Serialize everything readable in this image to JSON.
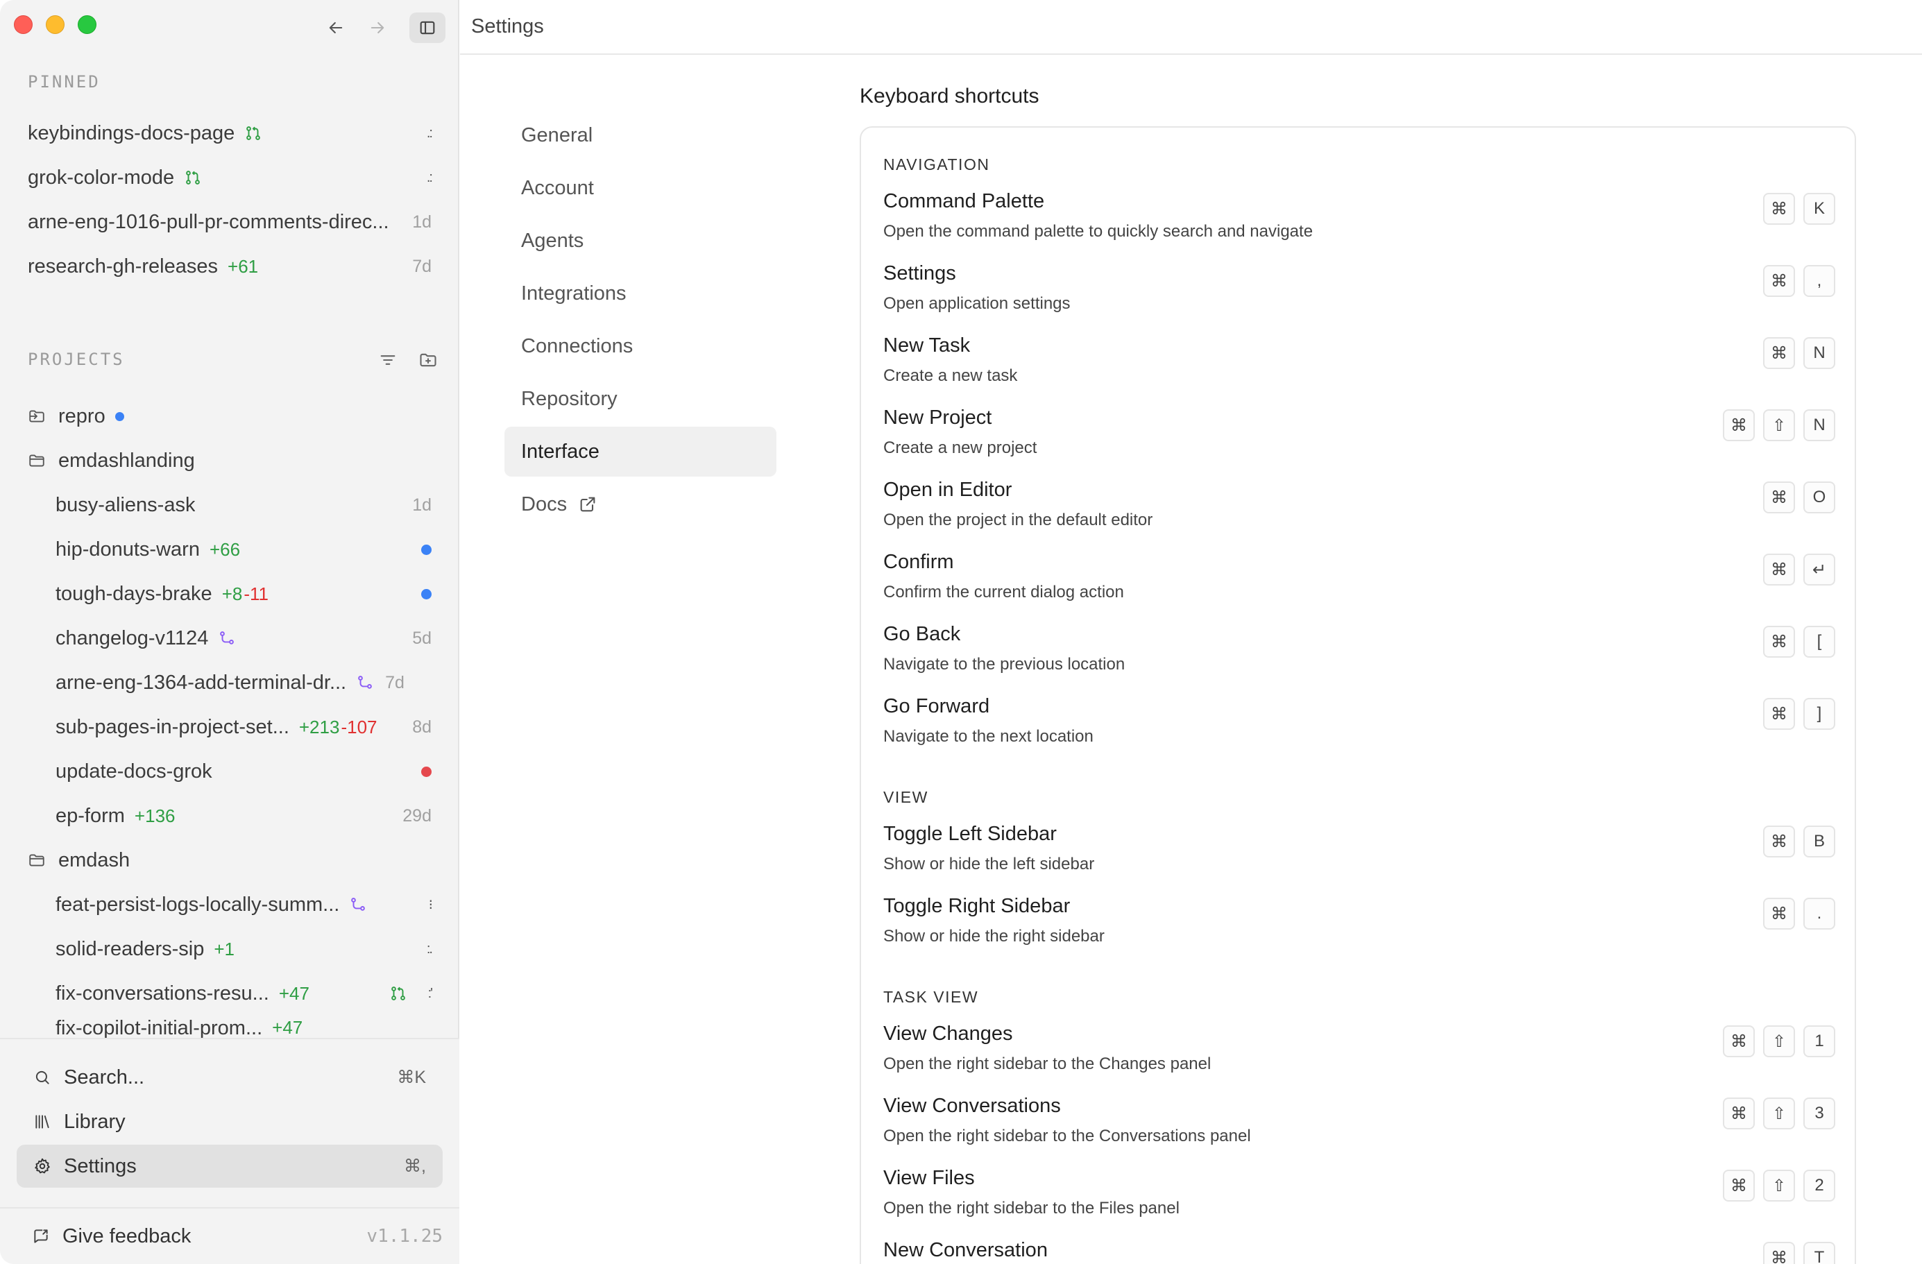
{
  "sidebar": {
    "pinned_label": "PINNED",
    "pinned": [
      {
        "name": "keybindings-docs-page",
        "meta": "",
        "icon": "pull-request-icon"
      },
      {
        "name": "grok-color-mode",
        "meta": "",
        "icon": "pull-request-icon"
      },
      {
        "name": "arne-eng-1016-pull-pr-comments-direc...",
        "meta": "1d"
      },
      {
        "name": "research-gh-releases",
        "added": "+61",
        "meta": "7d"
      }
    ],
    "projects_label": "PROJECTS",
    "projects": [
      {
        "name": "repro",
        "status": "blue"
      },
      {
        "name": "emdashlanding",
        "tasks": [
          {
            "name": "busy-aliens-ask",
            "meta": "1d"
          },
          {
            "name": "hip-donuts-warn",
            "added": "+66",
            "status": "blue"
          },
          {
            "name": "tough-days-brake",
            "added": "+8",
            "removed": "-11",
            "status": "blue"
          },
          {
            "name": "changelog-v1124",
            "meta": "5d",
            "icon": "merged-icon"
          },
          {
            "name": "arne-eng-1364-add-terminal-dr...",
            "meta": "7d",
            "icon": "merged-icon"
          },
          {
            "name": "sub-pages-in-project-set...",
            "added": "+213",
            "removed": "-107",
            "meta": "8d"
          },
          {
            "name": "update-docs-grok",
            "status": "red"
          },
          {
            "name": "ep-form",
            "added": "+136",
            "meta": "29d"
          }
        ]
      },
      {
        "name": "emdash",
        "tasks": [
          {
            "name": "feat-persist-logs-locally-summ...",
            "icon": "merged-icon"
          },
          {
            "name": "solid-readers-sip",
            "added": "+1"
          },
          {
            "name": "fix-conversations-resu...",
            "added": "+47",
            "icon": "pull-request-icon"
          },
          {
            "name": "fix-copilot-initial-prom...",
            "added": "+47",
            "icon": "pull-request-icon"
          }
        ]
      }
    ],
    "search": {
      "label": "Search...",
      "shortcut": "⌘K"
    },
    "library": {
      "label": "Library"
    },
    "settings": {
      "label": "Settings",
      "shortcut": "⌘,"
    },
    "feedback": {
      "label": "Give feedback"
    },
    "version": "v1.1.25"
  },
  "topbar": {
    "title": "Settings"
  },
  "settings_nav": [
    "General",
    "Account",
    "Agents",
    "Integrations",
    "Connections",
    "Repository",
    "Interface",
    "Docs"
  ],
  "settings_nav_active": "Interface",
  "content": {
    "title": "Keyboard shortcuts",
    "groups": [
      {
        "label": "NAVIGATION",
        "items": [
          {
            "title": "Command Palette",
            "desc": "Open the command palette to quickly search and navigate",
            "keys": [
              "⌘",
              "K"
            ]
          },
          {
            "title": "Settings",
            "desc": "Open application settings",
            "keys": [
              "⌘",
              ","
            ]
          },
          {
            "title": "New Task",
            "desc": "Create a new task",
            "keys": [
              "⌘",
              "N"
            ]
          },
          {
            "title": "New Project",
            "desc": "Create a new project",
            "keys": [
              "⌘",
              "⇧",
              "N"
            ]
          },
          {
            "title": "Open in Editor",
            "desc": "Open the project in the default editor",
            "keys": [
              "⌘",
              "O"
            ]
          },
          {
            "title": "Confirm",
            "desc": "Confirm the current dialog action",
            "keys": [
              "⌘",
              "↵"
            ]
          },
          {
            "title": "Go Back",
            "desc": "Navigate to the previous location",
            "keys": [
              "⌘",
              "["
            ]
          },
          {
            "title": "Go Forward",
            "desc": "Navigate to the next location",
            "keys": [
              "⌘",
              "]"
            ]
          }
        ]
      },
      {
        "label": "VIEW",
        "items": [
          {
            "title": "Toggle Left Sidebar",
            "desc": "Show or hide the left sidebar",
            "keys": [
              "⌘",
              "B"
            ]
          },
          {
            "title": "Toggle Right Sidebar",
            "desc": "Show or hide the right sidebar",
            "keys": [
              "⌘",
              "."
            ]
          }
        ]
      },
      {
        "label": "TASK VIEW",
        "items": [
          {
            "title": "View Changes",
            "desc": "Open the right sidebar to the Changes panel",
            "keys": [
              "⌘",
              "⇧",
              "1"
            ]
          },
          {
            "title": "View Conversations",
            "desc": "Open the right sidebar to the Conversations panel",
            "keys": [
              "⌘",
              "⇧",
              "3"
            ]
          },
          {
            "title": "View Files",
            "desc": "Open the right sidebar to the Files panel",
            "keys": [
              "⌘",
              "⇧",
              "2"
            ]
          },
          {
            "title": "New Conversation",
            "desc": "",
            "keys": [
              "⌘",
              "T"
            ]
          }
        ]
      }
    ]
  }
}
